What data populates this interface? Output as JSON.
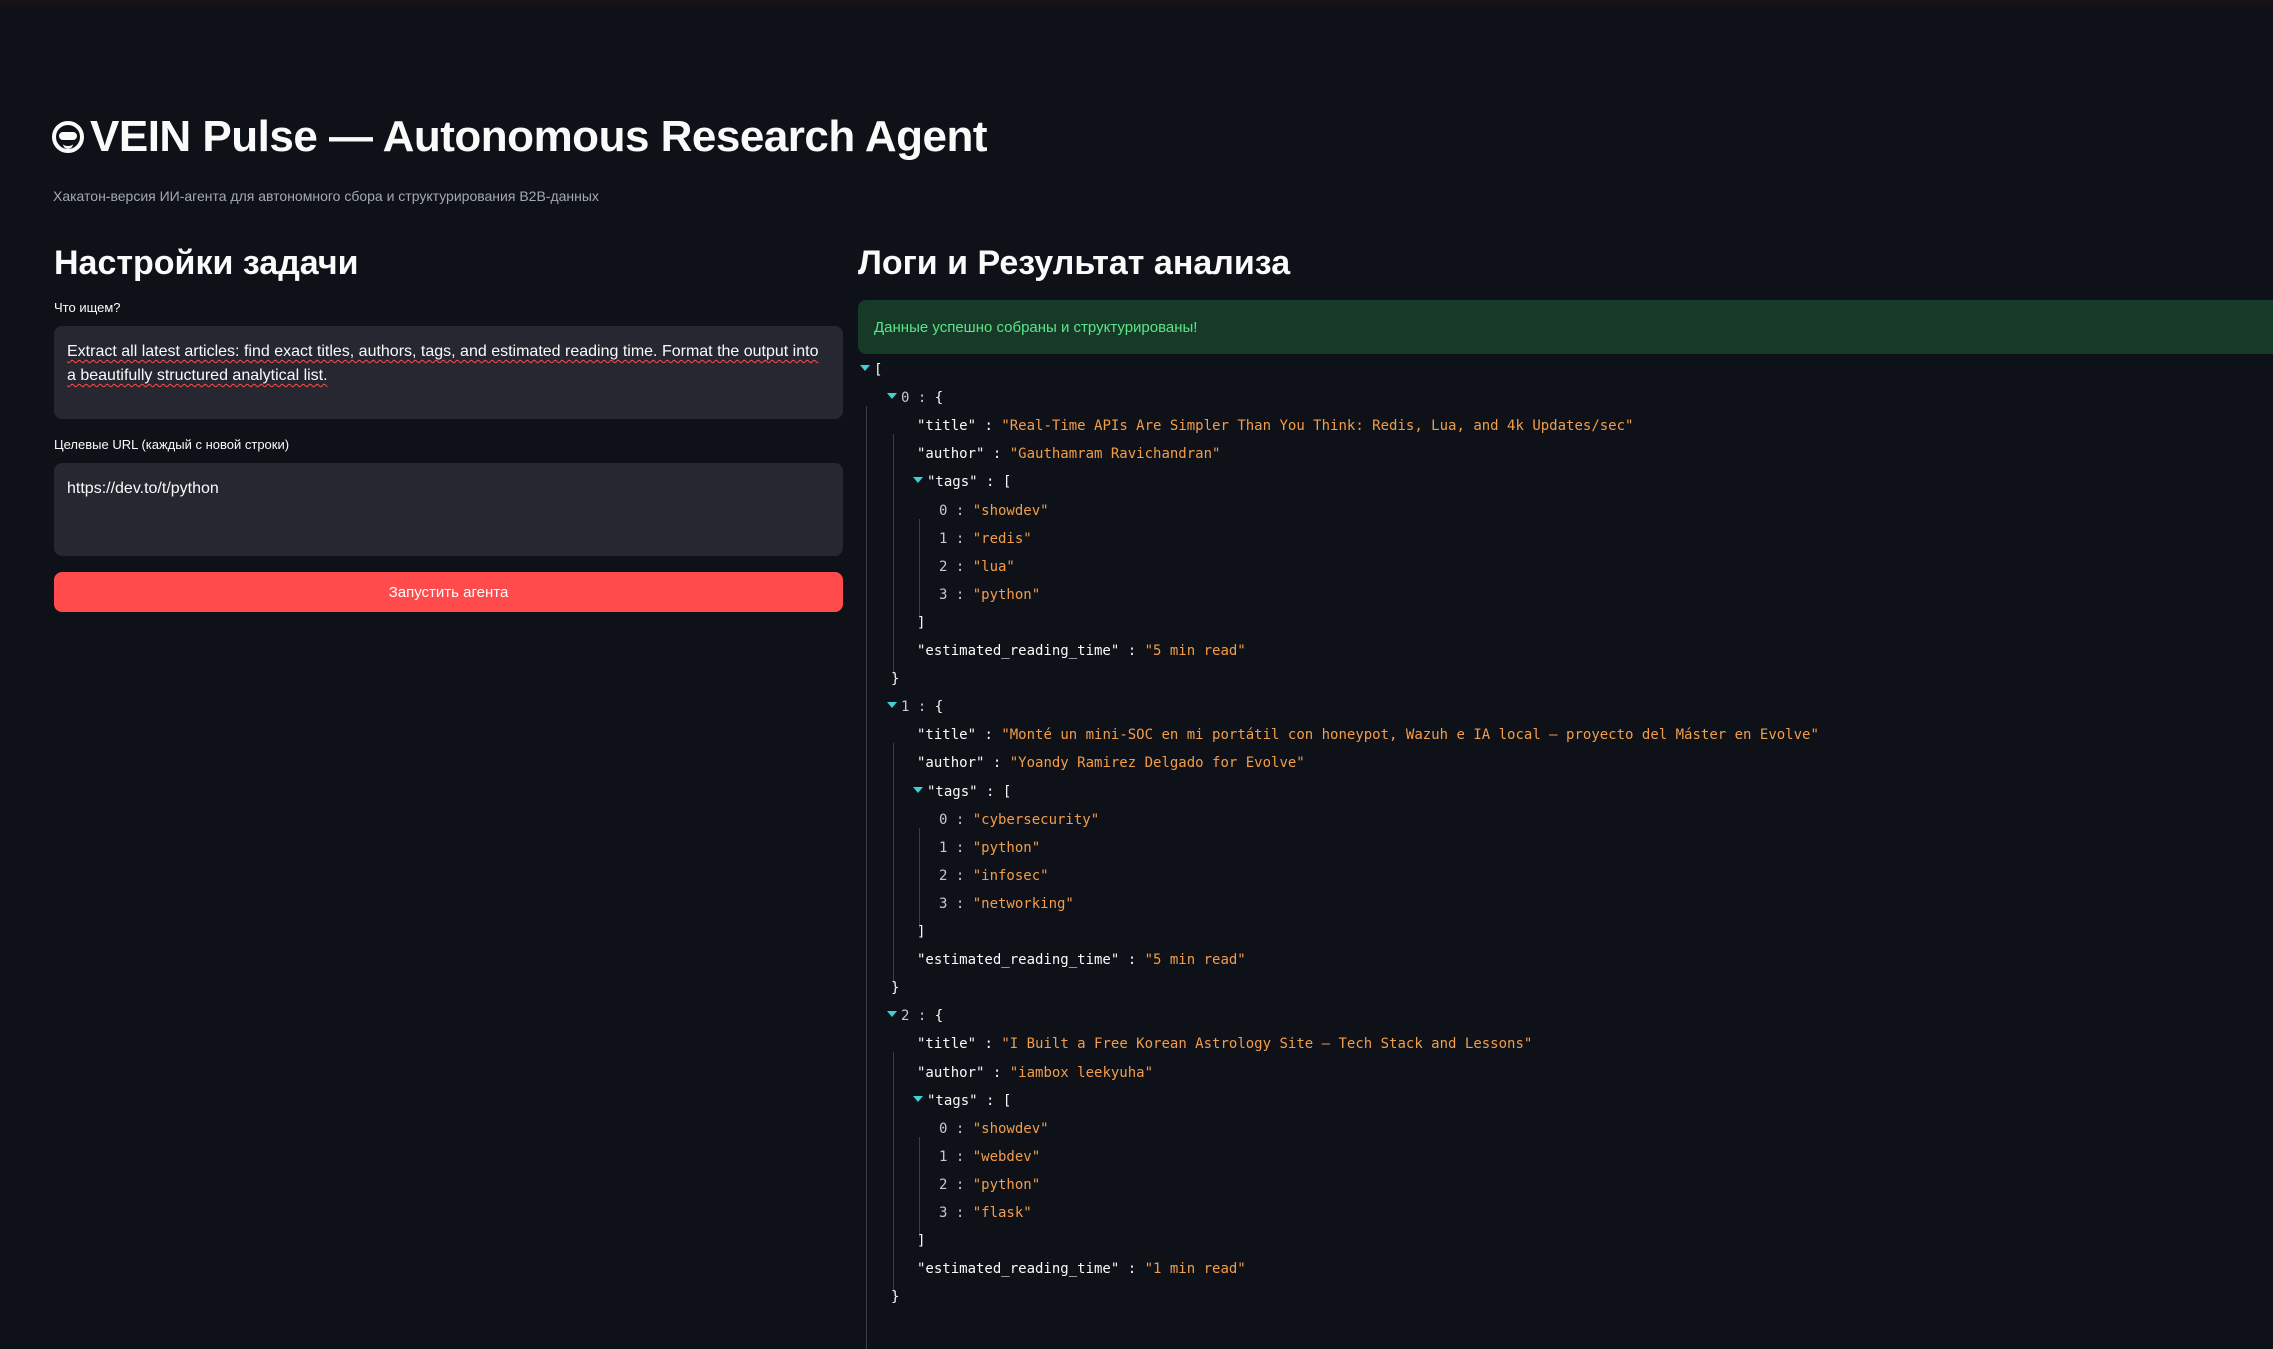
{
  "app": {
    "title": "VEIN Pulse — Autonomous Research Agent",
    "subtitle": "Хакатон-версия ИИ-агента для автономного сбора и структурирования B2B-данных",
    "icon": "robot-face-icon"
  },
  "settings": {
    "heading": "Настройки задачи",
    "query_label": "Что ищем?",
    "query_value": "Extract all latest articles: find exact titles, authors, tags, and estimated reading time. Format the output into a beautifully structured analytical list.",
    "urls_label": "Целевые URL (каждый с новой строки)",
    "urls_value": "https://dev.to/t/python",
    "run_button": "Запустить агента",
    "accent_color": "#ff4b4b"
  },
  "results": {
    "heading": "Логи и Результат анализа",
    "success_message": "Данные успешно собраны и структурированы!",
    "articles": [
      {
        "title": "Real-Time APIs Are Simpler Than You Think: Redis, Lua, and 4k Updates/sec",
        "author": "Gauthamram Ravichandran",
        "tags": [
          "showdev",
          "redis",
          "lua",
          "python"
        ],
        "estimated_reading_time": "5 min read"
      },
      {
        "title": "Monté un mini-SOC en mi portátil con honeypot, Wazuh e IA local — proyecto del Máster en Evolve",
        "author": "Yoandy Ramirez Delgado for Evolve",
        "tags": [
          "cybersecurity",
          "python",
          "infosec",
          "networking"
        ],
        "estimated_reading_time": "5 min read"
      },
      {
        "title": "I Built a Free Korean Astrology Site — Tech Stack and Lessons",
        "author": "iambox leekyuha",
        "tags": [
          "showdev",
          "webdev",
          "python",
          "flask"
        ],
        "estimated_reading_time": "1 min read"
      }
    ]
  }
}
